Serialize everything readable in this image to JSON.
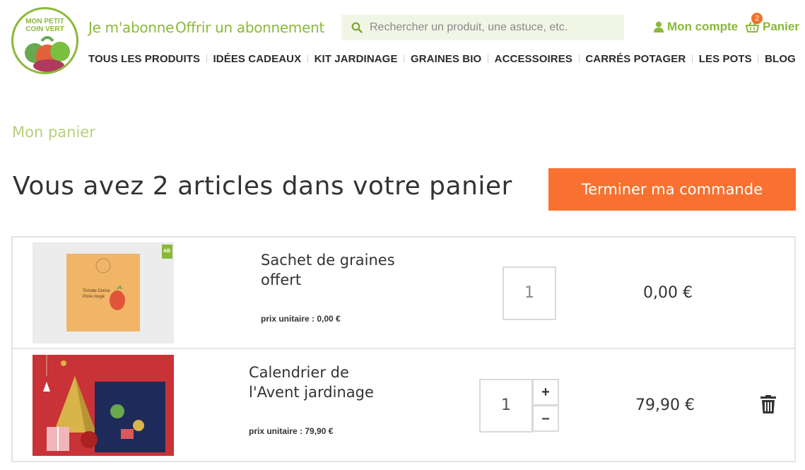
{
  "logo": {
    "text_line1": "MON PETIT",
    "text_line2": "COIN VERT"
  },
  "header": {
    "subscribe_link": "Je m'abonne",
    "gift_subscription_link": "Offrir un abonnement",
    "search_placeholder": "Rechercher un produit, une astuce, etc.",
    "account_label": "Mon compte",
    "cart_label": "Panier",
    "cart_count": "2"
  },
  "nav": {
    "items": [
      "TOUS LES PRODUITS",
      "IDÉES CADEAUX",
      "KIT JARDINAGE",
      "GRAINES BIO",
      "ACCESSOIRES",
      "CARRÉS POTAGER",
      "LES POTS",
      "BLOG"
    ]
  },
  "main": {
    "breadcrumb": "Mon panier",
    "title": "Vous avez 2 articles dans votre panier",
    "checkout_button": "Terminer ma commande",
    "items": [
      {
        "name": "Sachet de graines offert",
        "unit_price_label": "prix unitaire : 0,00 €",
        "quantity": "1",
        "price": "0,00 €",
        "badge": "AB",
        "packet_text_line1": "Tomate Cerise",
        "packet_text_line2": "Poire rouge"
      },
      {
        "name": "Calendrier de l'Avent jardinage",
        "unit_price_label": "prix unitaire : 79,90 €",
        "quantity": "1",
        "price": "79,90 €",
        "plus_label": "+",
        "minus_label": "–"
      }
    ]
  },
  "colors": {
    "brand_green": "#8bb83a",
    "accent_orange": "#f87130",
    "search_bg": "#f1f5e6"
  }
}
